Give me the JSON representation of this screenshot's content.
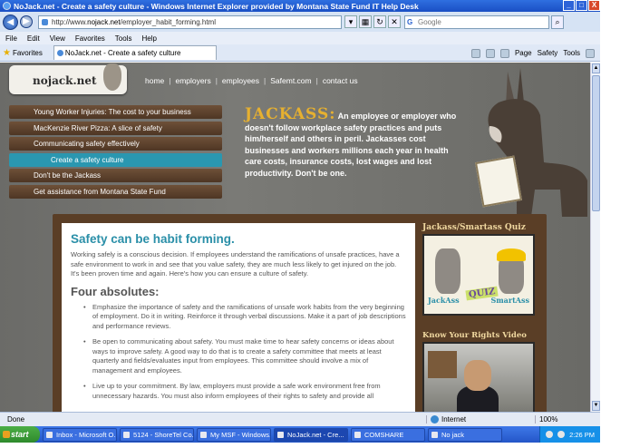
{
  "window": {
    "title": "NoJack.net - Create a safety culture - Windows Internet Explorer provided by Montana State Fund IT Help Desk",
    "buttons": [
      "_",
      "□",
      "X"
    ]
  },
  "addressbar": {
    "url_prefix": "http://www.",
    "url_domain": "nojack.net",
    "url_path": "/employer_habit_forming.html",
    "search_placeholder": "Google"
  },
  "menu": [
    "File",
    "Edit",
    "View",
    "Favorites",
    "Tools",
    "Help"
  ],
  "tabs": {
    "favorites": "Favorites",
    "active_tab": "NoJack.net - Create a safety culture"
  },
  "toolbar": {
    "page": "Page",
    "safety": "Safety",
    "tools": "Tools"
  },
  "site": {
    "logo_text": "nojack.net",
    "topnav": [
      "home",
      "employers",
      "employees",
      "Safemt.com",
      "contact us"
    ],
    "sidebar": [
      {
        "label": "Young Worker Injuries: The cost to your business",
        "active": false
      },
      {
        "label": "MacKenzie River Pizza: A slice of safety",
        "active": false
      },
      {
        "label": "Communicating safety effectively",
        "active": false
      },
      {
        "label": "Create a safety culture",
        "active": true
      },
      {
        "label": "Don't be the Jackass",
        "active": false
      },
      {
        "label": "Get assistance from Montana State Fund",
        "active": false
      }
    ],
    "jackass_word": "JACKASS:",
    "jackass_def": "An employee or employer who doesn't follow workplace safety practices and puts him/herself and others in peril. Jackasses cost businesses and workers millions each year in health care costs, insurance costs, lost wages and lost productivity. Don't be one."
  },
  "content": {
    "heading": "Safety can be habit forming.",
    "intro": "Working safely is a conscious decision. If employees understand the ramifications of unsafe practices, have a safe environment to work in and see that you value safety, they are much less likely to get injured on the job. It's been proven time and again. Here's how you can ensure a culture of safety.",
    "subheading": "Four absolutes:",
    "bullets": [
      "Emphasize the importance of safety and the ramifications of unsafe work habits from the very beginning of employment. Do it in writing. Reinforce it through verbal discussions. Make it a part of job descriptions and performance reviews.",
      "Be open to communicating about safety. You must make time to hear safety concerns or ideas about ways to improve safety. A good way to do that is to create a safety committee that meets at least quarterly and fields/evaluates input from employees. This committee should involve a mix of management and employees.",
      "Live up to your commitment. By law, employers must provide a safe work environment free from unnecessary hazards. You must also inform employees of their rights to safety and provide all"
    ]
  },
  "promos": {
    "quiz_title": "Jackass/Smartass Quiz",
    "quiz_left": "JackAss",
    "quiz_mid": "QUIZ",
    "quiz_right": "SmartAss",
    "video_title": "Know Your Rights Video"
  },
  "status": {
    "text": "Done",
    "zone": "Internet",
    "zoom": "100%"
  },
  "taskbar": {
    "start": "start",
    "items": [
      {
        "label": "Inbox - Microsoft O...",
        "active": false
      },
      {
        "label": "5124 - ShoreTel Co...",
        "active": false
      },
      {
        "label": "My MSF - Windows...",
        "active": false
      },
      {
        "label": "NoJack.net - Cre...",
        "active": true
      },
      {
        "label": "COMSHARE",
        "active": false
      },
      {
        "label": "No jack",
        "active": false
      }
    ],
    "clock": "2:26 PM"
  }
}
